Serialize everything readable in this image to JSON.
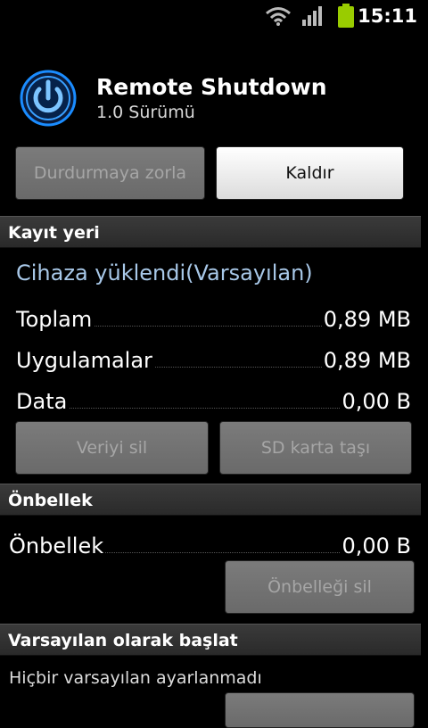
{
  "status_bar": {
    "time": "15:11",
    "icons": [
      "wifi-icon",
      "signal-icon",
      "battery-icon"
    ]
  },
  "app": {
    "name": "Remote Shutdown",
    "version": "1.0 Sürümü",
    "icon": "power-icon"
  },
  "actions": {
    "force_stop": "Durdurmaya zorla",
    "uninstall": "Kaldır"
  },
  "storage": {
    "header": "Kayıt yeri",
    "install_location": "Cihaza yüklendi(Varsayılan)",
    "rows": [
      {
        "label": "Toplam",
        "value": "0,89 MB"
      },
      {
        "label": "Uygulamalar",
        "value": "0,89 MB"
      },
      {
        "label": "Data",
        "value": "0,00 B"
      }
    ],
    "clear_data": "Veriyi sil",
    "move_to_sd": "SD karta taşı"
  },
  "cache": {
    "header": "Önbellek",
    "label": "Önbellek",
    "value": "0,00 B",
    "clear_cache": "Önbelleği sil"
  },
  "defaults": {
    "header": "Varsayılan olarak başlat",
    "text": "Hiçbir varsayılan ayarlanmadı"
  },
  "colors": {
    "accent_blue": "#1a8cff",
    "link_blue": "#a8c8e8",
    "battery_green": "#99cc00"
  }
}
